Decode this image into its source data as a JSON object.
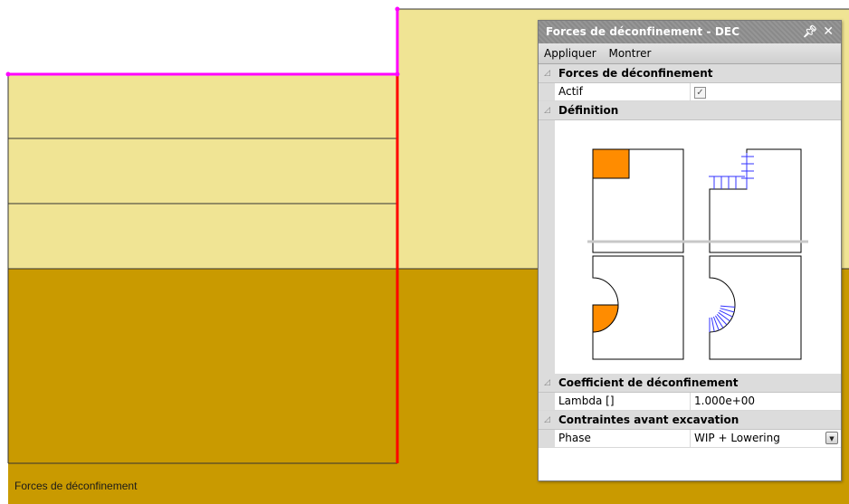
{
  "colors": {
    "upper_soil": "#f0e494",
    "lower_soil": "#c99a00",
    "excavation_line": "#ff00ff",
    "wall": "#ff0000",
    "illustration_fill": "#ff8c00",
    "force_arrows": "#3333ff"
  },
  "statusbar": {
    "text": "Forces de déconfinement"
  },
  "panel": {
    "title": "Forces de déconfinement - DEC",
    "pin_icon": "pin-icon",
    "close_icon": "close-icon",
    "menu": [
      "Appliquer",
      "Montrer"
    ],
    "sections": {
      "forces": {
        "header": "Forces de déconfinement",
        "actif_label": "Actif",
        "actif_checked": true
      },
      "definition": {
        "header": "Définition"
      },
      "coefficient": {
        "header": "Coefficient de déconfinement",
        "lambda_label": "Lambda []",
        "lambda_value": "1.000e+00"
      },
      "contraintes": {
        "header": "Contraintes avant excavation",
        "phase_label": "Phase",
        "phase_value": "WIP + Lowering"
      }
    }
  }
}
